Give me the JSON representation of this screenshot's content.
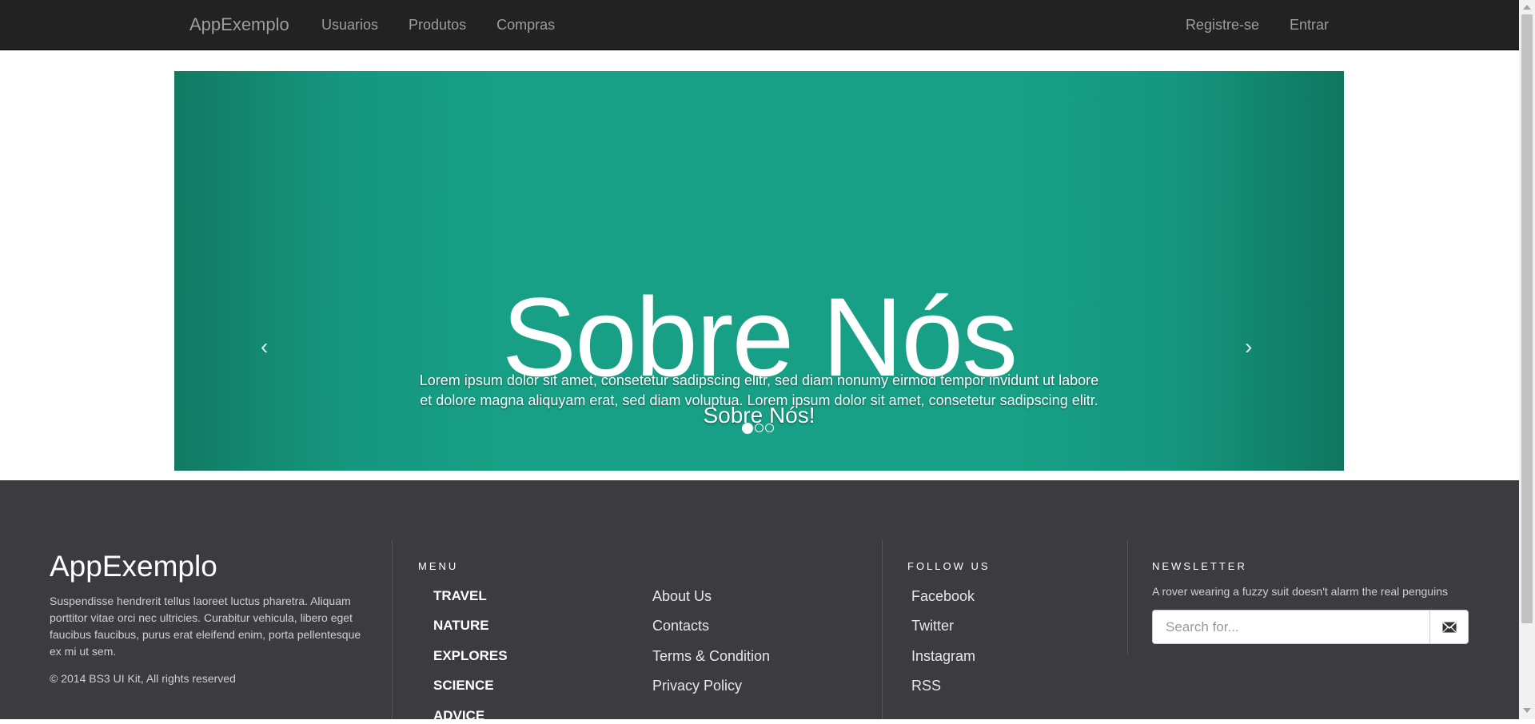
{
  "navbar": {
    "brand": "AppExemplo",
    "left_links": [
      "Usuarios",
      "Produtos",
      "Compras"
    ],
    "right_links": [
      "Registre-se",
      "Entrar"
    ]
  },
  "carousel": {
    "slide_image_text": "Sobre Nós",
    "caption_title": "Sobre Nós!",
    "caption_text": "Lorem ipsum dolor sit amet, consetetur sadipscing elitr, sed diam nonumy eirmod tempor invidunt ut labore et dolore magna aliquyam erat, sed diam voluptua. Lorem ipsum dolor sit amet, consetetur sadipscing elitr.",
    "prev_glyph": "‹",
    "next_glyph": "›",
    "slide_count": 3,
    "active_slide": 1,
    "colors": {
      "slide_bg": "#17a085",
      "slide_edge": "#0f7660"
    }
  },
  "footer": {
    "brand": "AppExemplo",
    "description": "Suspendisse hendrerit tellus laoreet luctus pharetra. Aliquam porttitor vitae orci nec ultricies. Curabitur vehicula, libero eget faucibus faucibus, purus erat eleifend enim, porta pellentesque ex mi ut sem.",
    "copyright": "© 2014 BS3 UI Kit, All rights reserved",
    "menu": {
      "heading": "MENU",
      "categories": [
        "TRAVEL",
        "NATURE",
        "EXPLORES",
        "SCIENCE",
        "ADVICE"
      ],
      "links": [
        "About Us",
        "Contacts",
        "Terms & Condition",
        "Privacy Policy"
      ]
    },
    "follow": {
      "heading": "FOLLOW US",
      "links": [
        "Facebook",
        "Twitter",
        "Instagram",
        "RSS"
      ]
    },
    "newsletter": {
      "heading": "NEWSLETTER",
      "tagline": "A rover wearing a fuzzy suit doesn't alarm the real penguins",
      "placeholder": "Search for...",
      "button_icon": "envelope-icon"
    },
    "colors": {
      "bg": "#3b3b40"
    }
  },
  "scrollbar": {
    "position_fraction": 0.0
  }
}
